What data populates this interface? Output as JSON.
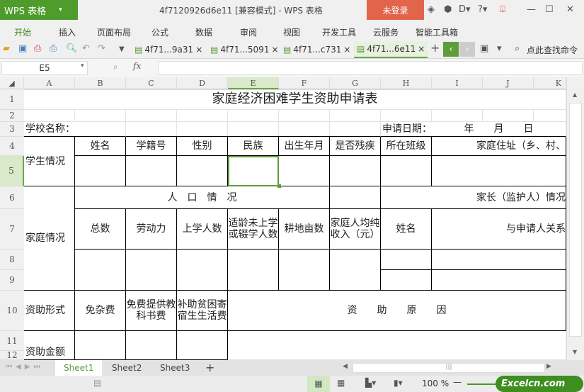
{
  "app": {
    "logo": "WPS 表格",
    "title": "4f7120926d6e11 [兼容模式] - WPS 表格",
    "login": "未登录"
  },
  "menu": [
    "开始",
    "插入",
    "页面布局",
    "公式",
    "数据",
    "审阅",
    "视图",
    "开发工具",
    "云服务",
    "智能工具箱"
  ],
  "doc_tabs": [
    "4f71...9a31",
    "4f71...5091",
    "4f71...c731",
    "4f71...6e11"
  ],
  "search_cmd": "点此查找命令",
  "namebox": "E5",
  "fx": "fx",
  "columns": [
    "A",
    "B",
    "C",
    "D",
    "E",
    "F",
    "G",
    "H",
    "I",
    "J",
    "K"
  ],
  "rows": [
    "1",
    "2",
    "3",
    "4",
    "5",
    "6",
    "7",
    "8",
    "9",
    "10",
    "11",
    "12"
  ],
  "cells": {
    "title": "家庭经济困难学生资助申请表",
    "school": "学校名称：",
    "apply_date": "申请日期：",
    "ymd": "年　　月　　日",
    "student_info": "学生情况",
    "name": "姓名",
    "student_no": "学籍号",
    "gender": "性别",
    "ethnicity": "民族",
    "birth": "出生年月",
    "disabled": "是否残疾",
    "class": "所在班级",
    "address": "家庭住址（乡、村、",
    "family_info": "家庭情况",
    "population": "人　口　情　况",
    "guardian": "家长（监护人）情况",
    "total": "总数",
    "labor": "劳动力",
    "students": "上学人数",
    "dropout": "适龄未上学或辍学人数",
    "land": "耕地亩数",
    "income": "家庭人均纯收入（元）",
    "g_name": "姓名",
    "relation": "与申请人关系",
    "aid_form": "资助形式",
    "free_fees": "免杂费",
    "free_books": "免费提供教科书费",
    "boarding": "补助贫困寄宿生生活费",
    "aid_reason": "资　　助　　原　　因",
    "aid_amount": "资助金额"
  },
  "sheets": [
    "Sheet1",
    "Sheet2",
    "Sheet3"
  ],
  "zoom": "100 %",
  "watermark": "Excelcn.com"
}
